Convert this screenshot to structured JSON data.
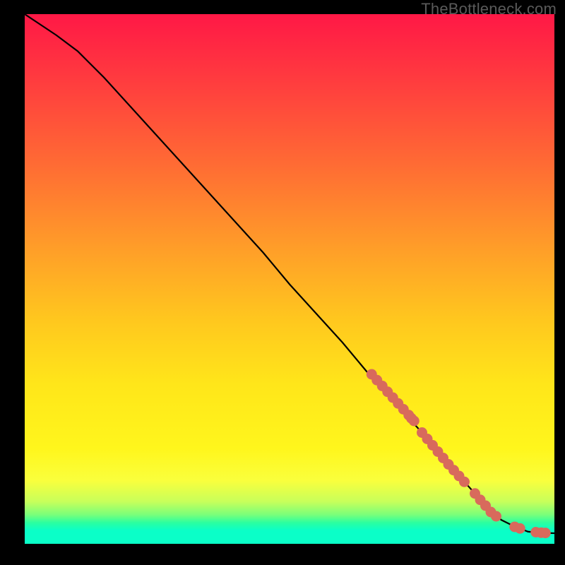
{
  "watermark": "TheBottleneck.com",
  "chart_data": {
    "type": "line",
    "title": "",
    "xlabel": "",
    "ylabel": "",
    "xlim": [
      0,
      100
    ],
    "ylim": [
      0,
      100
    ],
    "grid": false,
    "series": [
      {
        "name": "curve",
        "style": "line",
        "color": "#000000",
        "x": [
          0,
          3,
          6,
          10,
          15,
          20,
          25,
          30,
          35,
          40,
          45,
          50,
          55,
          60,
          65,
          70,
          75,
          80,
          85,
          88,
          90,
          92,
          95,
          97,
          100
        ],
        "y": [
          100,
          98,
          96,
          93,
          88,
          82.5,
          77,
          71.5,
          66,
          60.5,
          55,
          49,
          43.5,
          38,
          32,
          26.5,
          21,
          15,
          9.5,
          6,
          4.5,
          3.5,
          2.3,
          2.1,
          2
        ]
      },
      {
        "name": "dots-upper-run",
        "style": "scatter",
        "color": "#d86a5c",
        "x": [
          65.5,
          66.5,
          67.5,
          68.5,
          69.5,
          70.5,
          71.5,
          72.5,
          73.0,
          73.5
        ],
        "y": [
          32.0,
          30.9,
          29.8,
          28.7,
          27.6,
          26.5,
          25.4,
          24.3,
          23.7,
          23.2
        ]
      },
      {
        "name": "dots-mid-run",
        "style": "scatter",
        "color": "#d86a5c",
        "x": [
          75.0,
          76.0,
          77.0,
          78.0,
          79.0,
          80.0,
          81.0,
          82.0,
          83.0
        ],
        "y": [
          21.0,
          19.8,
          18.6,
          17.4,
          16.2,
          15.0,
          13.9,
          12.8,
          11.7
        ]
      },
      {
        "name": "dots-lower-run",
        "style": "scatter",
        "color": "#d86a5c",
        "x": [
          85.0,
          86.0,
          87.0,
          88.0,
          89.0
        ],
        "y": [
          9.5,
          8.3,
          7.2,
          6.0,
          5.2
        ]
      },
      {
        "name": "dots-tail",
        "style": "scatter",
        "color": "#d86a5c",
        "x": [
          92.5,
          93.5,
          96.5,
          97.5,
          98.3
        ],
        "y": [
          3.2,
          2.9,
          2.2,
          2.1,
          2.05
        ]
      }
    ]
  }
}
